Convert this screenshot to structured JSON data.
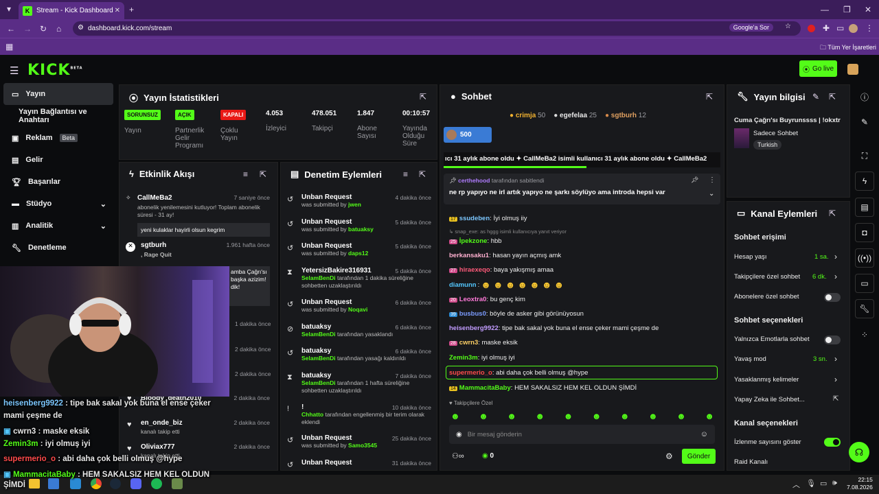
{
  "browser": {
    "tab_title": "Stream - Kick Dashboard",
    "url": "dashboard.kick.com/stream",
    "google_btn": "Google'a Sor",
    "bookmarks": "Tüm Yer İşaretleri"
  },
  "header": {
    "logo": "KICK",
    "logo_sup": "BETA",
    "go_live": "Go live"
  },
  "sidebar": {
    "items": [
      {
        "label": "Yayın"
      },
      {
        "label": "Yayın Bağlantısı ve Anahtarı"
      },
      {
        "label": "Reklam",
        "badge": "Beta"
      },
      {
        "label": "Gelir"
      },
      {
        "label": "Başarılar"
      },
      {
        "label": "Stüdyo"
      },
      {
        "label": "Analitik"
      },
      {
        "label": "Denetleme"
      }
    ]
  },
  "stats": {
    "title": "Yayın İstatistikleri",
    "items": [
      {
        "value": "SORUNSUZ",
        "label": "Yayın"
      },
      {
        "value": "AÇIK",
        "label": "Partnerlik Gelir Programı"
      },
      {
        "value": "KAPALI",
        "label": "Çoklu Yayın"
      },
      {
        "value": "4.053",
        "label": "İzleyici"
      },
      {
        "value": "478.051",
        "label": "Takipçi"
      },
      {
        "value": "1.847",
        "label": "Abone Sayısı"
      },
      {
        "value": "00:10:57",
        "label": "Yayında Olduğu Süre"
      }
    ]
  },
  "activity": {
    "title": "Etkinlik Akışı",
    "items": [
      {
        "name": "CallMeBa2",
        "time": "7 saniye önce",
        "sub": "abonelik yenilemesini kutluyor! Toplam abonelik süresi - 31 ay!",
        "msg": "yeni kulaklar hayirli olsun kegrim"
      },
      {
        "name": "sgtburh",
        "time": "1.961 hafta önce",
        "sub": ", Rage Quit",
        "msg": "amba Çağrı'sı başka azizim! dik!"
      },
      {
        "name": "",
        "time": "1 dakika önce",
        "sub": ""
      },
      {
        "name": "",
        "time": "2 dakika önce",
        "sub": ""
      },
      {
        "name": "",
        "time": "2 dakika önce",
        "sub": ""
      },
      {
        "name": "Bloody_death2010",
        "time": "2 dakika önce",
        "sub": ""
      },
      {
        "name": "en_onde_biz",
        "time": "2 dakika önce",
        "sub": "kanalı takip etti"
      },
      {
        "name": "Oliviax777",
        "time": "2 dakika önce",
        "sub": "kanalı takip etti"
      }
    ]
  },
  "moderation": {
    "title": "Denetim Eylemleri",
    "items": [
      {
        "name": "Unban Request",
        "time": "4 dakika önce",
        "sub": "was submitted by ",
        "by": "jwen"
      },
      {
        "name": "Unban Request",
        "time": "5 dakika önce",
        "sub": "was submitted by ",
        "by": "batuaksy"
      },
      {
        "name": "Unban Request",
        "time": "5 dakika önce",
        "sub": "was submitted by ",
        "by": "daps12"
      },
      {
        "name": "YetersizBakire316931",
        "time": "5 dakika önce",
        "by": "SelamBenDi",
        "sub": " tarafından 1 dakika süreliğine sohbetten uzaklaştırıldı"
      },
      {
        "name": "Unban Request",
        "time": "6 dakika önce",
        "sub": "was submitted by ",
        "by": "Noqavi"
      },
      {
        "name": "batuaksy",
        "time": "6 dakika önce",
        "by": "SelamBenDi",
        "sub": " tarafından yasaklandı"
      },
      {
        "name": "batuaksy",
        "time": "6 dakika önce",
        "by": "SelamBenDi",
        "sub": " tarafından yasağı kaldırıldı"
      },
      {
        "name": "batuaksy",
        "time": "7 dakika önce",
        "by": "SelamBenDi",
        "sub": " tarafından 1 hafta süreliğine sohbetten uzaklaştırıldı"
      },
      {
        "name": "!",
        "time": "10 dakika önce",
        "by": "Chhatto",
        "sub": " tarafından engellenmiş bir terim olarak eklendi"
      },
      {
        "name": "Unban Request",
        "time": "25 dakika önce",
        "sub": "was submitted by ",
        "by": "Samo3545"
      },
      {
        "name": "Unban Request",
        "time": "31 dakika önce",
        "sub": ""
      }
    ]
  },
  "chat": {
    "title": "Sohbet",
    "leaders": [
      {
        "name": "crimja",
        "n": "50"
      },
      {
        "name": "egefelaa",
        "n": "25"
      },
      {
        "name": "sgtburh",
        "n": "12"
      }
    ],
    "goal": "500",
    "banner": "ıcı 31 aylık abone oldu  ✦ CallMeBa2 isimli kullanıcı 31 aylık abone oldu  ✦ CallMeBa2",
    "pinned_by": "certhehood",
    "pinned_suffix": "tarafından sabitlendi",
    "pinned_msg": "ne rp yapıyo ne irl artık yapıyo ne şarkı söylüyo ama introda hepsi var",
    "messages": [
      {
        "lvl": "17",
        "user": "ssudeben",
        "color": "#7cc7ff",
        "text": "İyi olmuş iiy"
      },
      {
        "lvl": "",
        "user": "snap_exe",
        "color": "#888",
        "text": "snap_exe: as hggg isimli kullanıcıya yanıt veriyor",
        "reply": true
      },
      {
        "lvl": "25",
        "user": "İpekzone",
        "color": "#53fc18",
        "text": "hbb"
      },
      {
        "lvl": "",
        "user": "berkansaku1",
        "color": "#ffb0d0",
        "text": "hasan yayın açmış amk"
      },
      {
        "lvl": "27",
        "user": "hiraexeqo",
        "color": "#ff5a7a",
        "text": "baya yakışmış amaa"
      },
      {
        "lvl": "",
        "user": "diamunn",
        "color": "#53c7ff",
        "text": ""
      },
      {
        "lvl": "20",
        "user": "Leoxtra0",
        "color": "#ff7ad9",
        "text": "bu genç kim"
      },
      {
        "lvl": "39",
        "user": "busbus0",
        "color": "#7c9cff",
        "text": "böyle de asker gibi görünüyosun"
      },
      {
        "lvl": "",
        "user": "heisenberg9922",
        "color": "#c29cff",
        "text": "tipe bak sakal yok buna el ense çeker mami çeşme de"
      },
      {
        "lvl": "28",
        "user": "cwrn3",
        "color": "#ffd166",
        "text": "maske eksik"
      },
      {
        "lvl": "",
        "user": "Zemin3m",
        "color": "#53fc18",
        "text": "iyi olmuş iyi"
      },
      {
        "lvl": "",
        "user": "supermerio_o",
        "color": "#ff4b4b",
        "text": "abi daha çok belli olmuş @hype"
      },
      {
        "lvl": "14",
        "user": "MammacitaBaby",
        "color": "#53fc18",
        "text": "HEM SAKALSIZ HEM KEL OLDUN ŞİMDİ"
      }
    ],
    "followers_only": "Takipçilere Özel",
    "placeholder": "Bir mesaj gönderin",
    "points": "0",
    "send": "Gönder"
  },
  "info": {
    "title": "Yayın bilgisi",
    "stream_title": "Cuma Çağrı'sı Buyrunssss | !okxtr",
    "category": "Sadece Sohbet",
    "tag": "Turkish"
  },
  "channel": {
    "title": "Kanal Eylemleri",
    "sec1": "Sohbet erişimi",
    "account_age": "Hesap yaşı",
    "account_age_val": "1 sa.",
    "followers_chat": "Takipçilere özel sohbet",
    "followers_chat_val": "6 dk.",
    "subs_chat": "Abonelere özel sohbet",
    "sec2": "Sohbet seçenekleri",
    "emote_only": "Yalnızca Emotlarla sohbet",
    "slow": "Yavaş mod",
    "slow_val": "3 sn.",
    "banned_words": "Yasaklanmış kelimeler",
    "ai": "Yapay Zeka ile Sohbet...",
    "sec3": "Kanal seçenekleri",
    "show_views": "İzlenme sayısını göster",
    "raid": "Raid Kanalı"
  },
  "overlay": {
    "lines": [
      {
        "user": "heisenberg9922",
        "color": "#7cc7ff",
        "text": " : tipe bak sakal yok buna el ense çeker"
      },
      {
        "user": "",
        "color": "#fff",
        "text": "mami çeşme de"
      },
      {
        "user": "cwrn3",
        "color": "#fff",
        "text": " : maske eksik"
      },
      {
        "user": "Zemin3m",
        "color": "#53fc18",
        "text": " : iyi olmuş iyi"
      },
      {
        "user": "supermerio_o",
        "color": "#ff4b4b",
        "text": " : abi daha çok belli olmuş @hype"
      },
      {
        "user": "MammacitaBaby",
        "color": "#53fc18",
        "text": " : HEM SAKALSIZ HEM KEL OLDUN"
      },
      {
        "user": "",
        "color": "#fff",
        "text": "ŞİMDİ"
      }
    ]
  },
  "taskbar": {
    "time": "22:15",
    "date": "7.08.2026"
  }
}
